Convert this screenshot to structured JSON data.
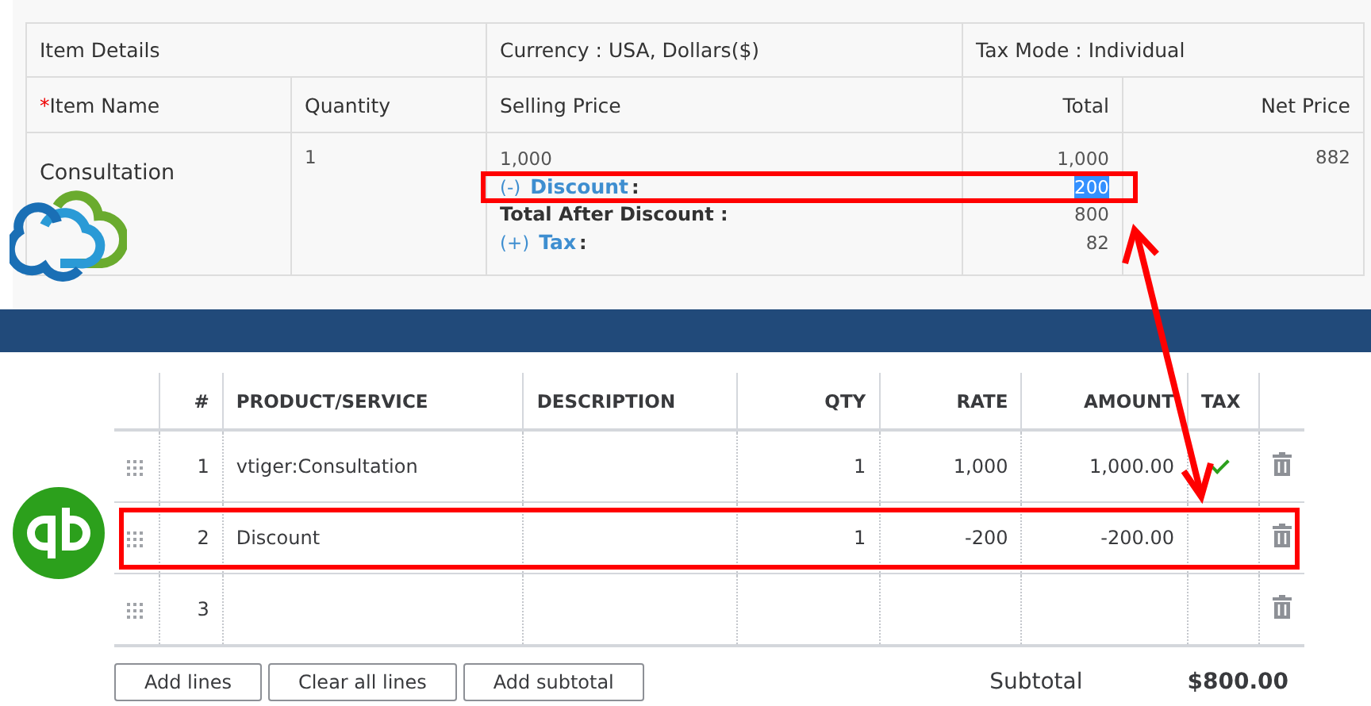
{
  "crm_table": {
    "header": [
      "Item Details",
      "Currency : USA, Dollars($)",
      "Tax Mode : Individual"
    ],
    "columns": [
      {
        "label": "Item Name",
        "required_mark": "*"
      },
      {
        "label": "Quantity"
      },
      {
        "label": "Selling Price"
      },
      {
        "label": "Total"
      },
      {
        "label": "Net Price"
      }
    ],
    "row": {
      "item_name": "Consultation",
      "quantity": "1",
      "net_price": "882",
      "price_lines": [
        {
          "kind": "value",
          "label": "1,000",
          "total": "1,000",
          "highlighted": false,
          "total_selected": false
        },
        {
          "kind": "link",
          "prefix": "(-)",
          "label": "Discount",
          "suffix": ":",
          "total": "200",
          "highlighted": true,
          "total_selected": true
        },
        {
          "kind": "bold",
          "label": "Total After Discount :",
          "total": "800",
          "highlighted": false,
          "total_selected": false
        },
        {
          "kind": "link",
          "prefix": "(+)",
          "label": "Tax",
          "suffix": ":",
          "total": "82",
          "highlighted": false,
          "total_selected": false
        }
      ]
    }
  },
  "invoice_table": {
    "columns": [
      "#",
      "PRODUCT/SERVICE",
      "DESCRIPTION",
      "QTY",
      "RATE",
      "AMOUNT",
      "TAX"
    ],
    "rows": [
      {
        "number": "1",
        "product": "vtiger:Consultation",
        "qty": "1",
        "rate": "1,000",
        "amount": "1,000.00",
        "taxable": true,
        "highlighted": false
      },
      {
        "number": "2",
        "product": "Discount",
        "qty": "1",
        "rate": "-200",
        "amount": "-200.00",
        "taxable": false,
        "highlighted": true
      },
      {
        "number": "3",
        "taxable": false,
        "highlighted": false
      }
    ],
    "buttons": [
      "Add lines",
      "Clear all lines",
      "Add subtotal"
    ],
    "subtotal": {
      "label": "Subtotal",
      "value": "$800.00"
    }
  }
}
